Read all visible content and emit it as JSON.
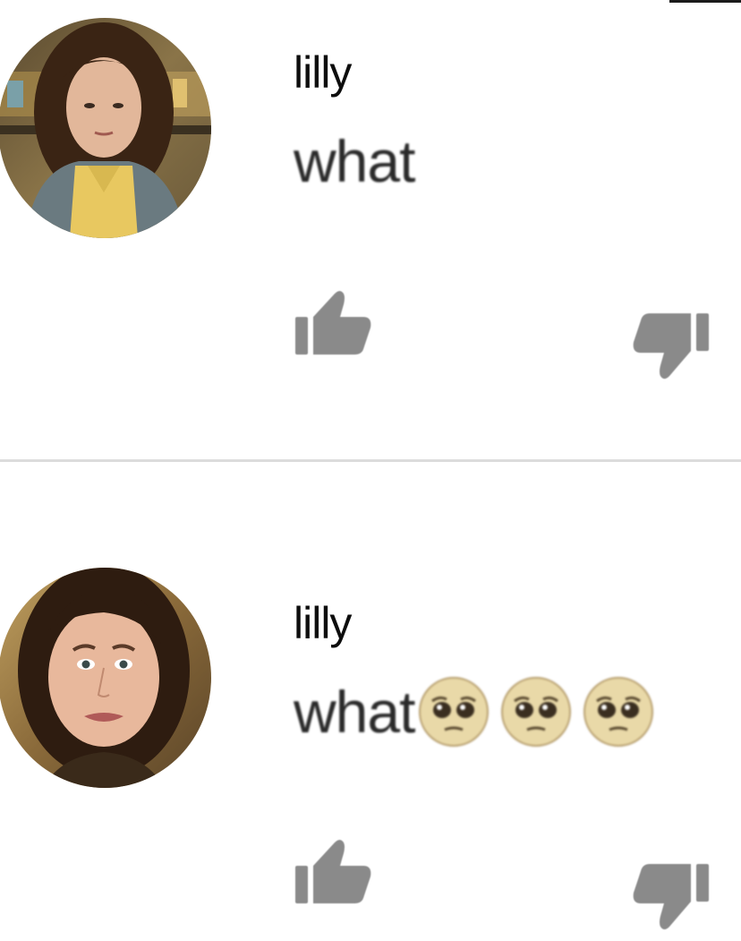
{
  "comments": [
    {
      "author": "lilly",
      "text": "what",
      "emojis": [],
      "avatar_icon": "profile-photo",
      "like_icon": "thumbs-up-icon",
      "dislike_icon": "thumbs-down-icon"
    },
    {
      "author": "lilly",
      "text": "what",
      "emojis": [
        "pleading-face",
        "pleading-face",
        "pleading-face"
      ],
      "avatar_icon": "profile-photo",
      "like_icon": "thumbs-up-icon",
      "dislike_icon": "thumbs-down-icon"
    }
  ],
  "colors": {
    "icon_gray": "#8a8a8a",
    "divider": "#dcdcdc",
    "text": "#2a2a2a"
  }
}
